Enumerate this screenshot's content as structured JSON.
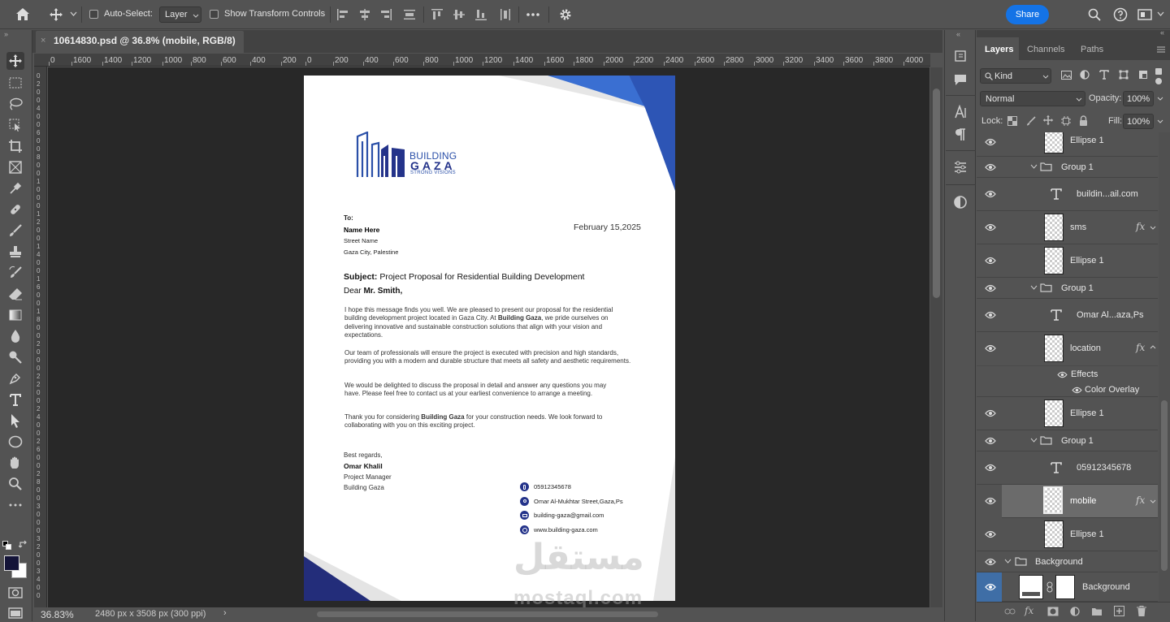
{
  "options_bar": {
    "auto_select_label": "Auto-Select:",
    "auto_select_value": "Layer",
    "show_transform_label": "Show Transform Controls",
    "share_label": "Share"
  },
  "document": {
    "tab_title": "10614830.psd @ 36.8% (mobile, RGB/8)"
  },
  "ruler": {
    "h_ticks": [
      "0",
      "1600",
      "1400",
      "1200",
      "1000",
      "800",
      "600",
      "400",
      "200",
      "0",
      "200",
      "400",
      "600",
      "800",
      "1000",
      "1200",
      "1400",
      "1600",
      "1800",
      "2000",
      "2200",
      "2400",
      "2600",
      "2800",
      "3000",
      "3200",
      "3400",
      "3600",
      "3800",
      "4000"
    ],
    "v_ticks": [
      "0",
      "2",
      "0",
      "0",
      "4",
      "0",
      "0",
      "6",
      "0",
      "0",
      "8",
      "0",
      "0",
      "1",
      "0",
      "0",
      "0",
      "1",
      "2",
      "0",
      "0",
      "1",
      "4",
      "0",
      "0",
      "1",
      "6",
      "0",
      "0",
      "1",
      "8",
      "0",
      "0",
      "2",
      "0",
      "0",
      "0",
      "2",
      "2",
      "0",
      "0",
      "2",
      "4",
      "0",
      "0",
      "2",
      "6",
      "0",
      "0",
      "2",
      "8",
      "0",
      "0",
      "3",
      "0",
      "0",
      "0",
      "3",
      "2",
      "0",
      "0",
      "3",
      "4",
      "0",
      "0"
    ]
  },
  "letter": {
    "logo_top": "BUILDING",
    "logo_main": "GAZA",
    "logo_tag": "STRONG VISIONS",
    "to_label": "To:",
    "name": "Name Here",
    "street": "Street Name",
    "city": "Gaza City, Palestine",
    "date": "February 15,2025",
    "subject_label": "Subject:",
    "subject_text": "Project Proposal for Residential Building Development",
    "greeting_pre": "Dear",
    "greeting_name": "Mr. Smith,",
    "p1_a": "I hope this message finds you well. We are pleased to present our proposal for the residential building development project located in Gaza City. At",
    "p1_bold": "Building Gaza",
    "p1_b": ", we pride ourselves on delivering innovative and sustainable construction solutions that align with your vision and expectations.",
    "p2": "Our team of professionals will ensure the project is executed with precision and high standards, providing you with a modern and durable structure that meets all safety and aesthetic requirements.",
    "p3": "We would be delighted to discuss the proposal in detail and answer any questions you may have. Please feel free to contact us at your earliest convenience to arrange a meeting.",
    "p4_a": "Thank you for considering",
    "p4_bold": "Building Gaza",
    "p4_b": "for your construction needs. We look forward to collaborating with you on this exciting project.",
    "regards": "Best regards,",
    "signer": "Omar Khalil",
    "role": "Project Manager",
    "company": "Building Gaza",
    "phone": "05912345678",
    "address": "Omar Al-Mukhtar Street,Gaza,Ps",
    "email": "building-gaza@gmail.com",
    "web": "www.building-gaza.com",
    "watermark_ar": "مستقل",
    "watermark_en": "mostaql.com"
  },
  "status": {
    "zoom": "36.83%",
    "doc_info": "2480 px x 3508 px (300 ppi)"
  },
  "layers_panel": {
    "tabs": [
      "Layers",
      "Channels",
      "Paths"
    ],
    "filter_kind": "Kind",
    "blend_mode": "Normal",
    "opacity_label": "Opacity:",
    "opacity_value": "100%",
    "lock_label": "Lock:",
    "fill_label": "Fill:",
    "fill_value": "100%",
    "layers": [
      {
        "name": "Ellipse 1",
        "kind": "shape"
      },
      {
        "name": "Group 1",
        "kind": "group"
      },
      {
        "name": "buildin...ail.com",
        "kind": "text"
      },
      {
        "name": "sms",
        "kind": "shape",
        "fx": "fx"
      },
      {
        "name": "Ellipse 1",
        "kind": "shape"
      },
      {
        "name": "Group 1",
        "kind": "group"
      },
      {
        "name": "Omar Al...aza,Ps",
        "kind": "text"
      },
      {
        "name": "location",
        "kind": "shape",
        "fx": "fx"
      },
      {
        "name": "Effects",
        "kind": "effects"
      },
      {
        "name": "Color Overlay",
        "kind": "effect"
      },
      {
        "name": "Ellipse 1",
        "kind": "shape"
      },
      {
        "name": "Group 1",
        "kind": "group"
      },
      {
        "name": "05912345678",
        "kind": "text"
      },
      {
        "name": "mobile",
        "kind": "shape",
        "fx": "fx",
        "selected": true
      },
      {
        "name": "Ellipse 1",
        "kind": "shape"
      },
      {
        "name": "Background",
        "kind": "group"
      },
      {
        "name": "Background",
        "kind": "masked"
      }
    ]
  },
  "colors": {
    "accent": "#1473e6",
    "navy": "#232d7a",
    "blue": "#2f63c8"
  }
}
